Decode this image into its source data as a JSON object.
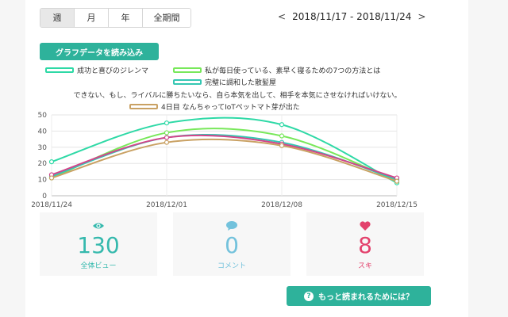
{
  "tabs": [
    {
      "label": "週",
      "active": true
    },
    {
      "label": "月"
    },
    {
      "label": "年"
    },
    {
      "label": "全期間"
    }
  ],
  "date_range": {
    "prev": "<",
    "text": "2018/11/17 - 2018/11/24",
    "next": ">"
  },
  "load_button": "グラフデータを読み込み",
  "legend": {
    "item1": "成功と喜びのジレンマ",
    "item2": "私が毎日使っている、素早く寝るための7つの方法とは",
    "item3": "完璧に調和した散髪屋",
    "cut_text": "できない、もし、ライバルに勝ちたいなら、自ら本気を出して、相手を本気にさせなければいけない。",
    "item5": "4日目 なんちゃってIoTペットマト芽が出た"
  },
  "chart_data": {
    "type": "line",
    "x": [
      "2018/11/24",
      "2018/12/01",
      "2018/12/08",
      "2018/12/15"
    ],
    "x_ticks": [
      "2018/11/24",
      "2018/12/01",
      "2018/12/08",
      "2018/12/15"
    ],
    "y_ticks": [
      0,
      10,
      20,
      30,
      40,
      50
    ],
    "ylim": [
      0,
      50
    ],
    "grid": true,
    "series": [
      {
        "name": "成功と喜びのジレンマ",
        "color": "#2ed9a6",
        "values": [
          21,
          45,
          44,
          8
        ]
      },
      {
        "name": "私が毎日使っている、素早く寝るための7つの方法とは",
        "color": "#78e85a",
        "values": [
          11,
          39,
          37,
          9
        ]
      },
      {
        "name": "完璧に調和した散髪屋",
        "color": "#35c7b3",
        "values": [
          12,
          36,
          33,
          10
        ]
      },
      {
        "name": "できない、もし、ライバルに勝ちたいなら、自ら本気を出して、相手を本気にさせなければいけない。",
        "color": "#d2458a",
        "values": [
          13,
          36,
          32,
          11
        ]
      },
      {
        "name": "4日目 なんちゃってIoTペットマト芽が出た",
        "color": "#c9a163",
        "values": [
          11,
          33,
          31,
          9
        ]
      }
    ]
  },
  "stats": [
    {
      "value": "130",
      "label": "全体ビュー",
      "color": "#35b9ad",
      "icon": "eye-icon"
    },
    {
      "value": "0",
      "label": "コメント",
      "color": "#73c2dc",
      "icon": "comment-icon"
    },
    {
      "value": "8",
      "label": "スキ",
      "color": "#e3416c",
      "icon": "heart-icon"
    }
  ],
  "cta": {
    "label": "もっと読まれるためには？",
    "icon": "?"
  }
}
